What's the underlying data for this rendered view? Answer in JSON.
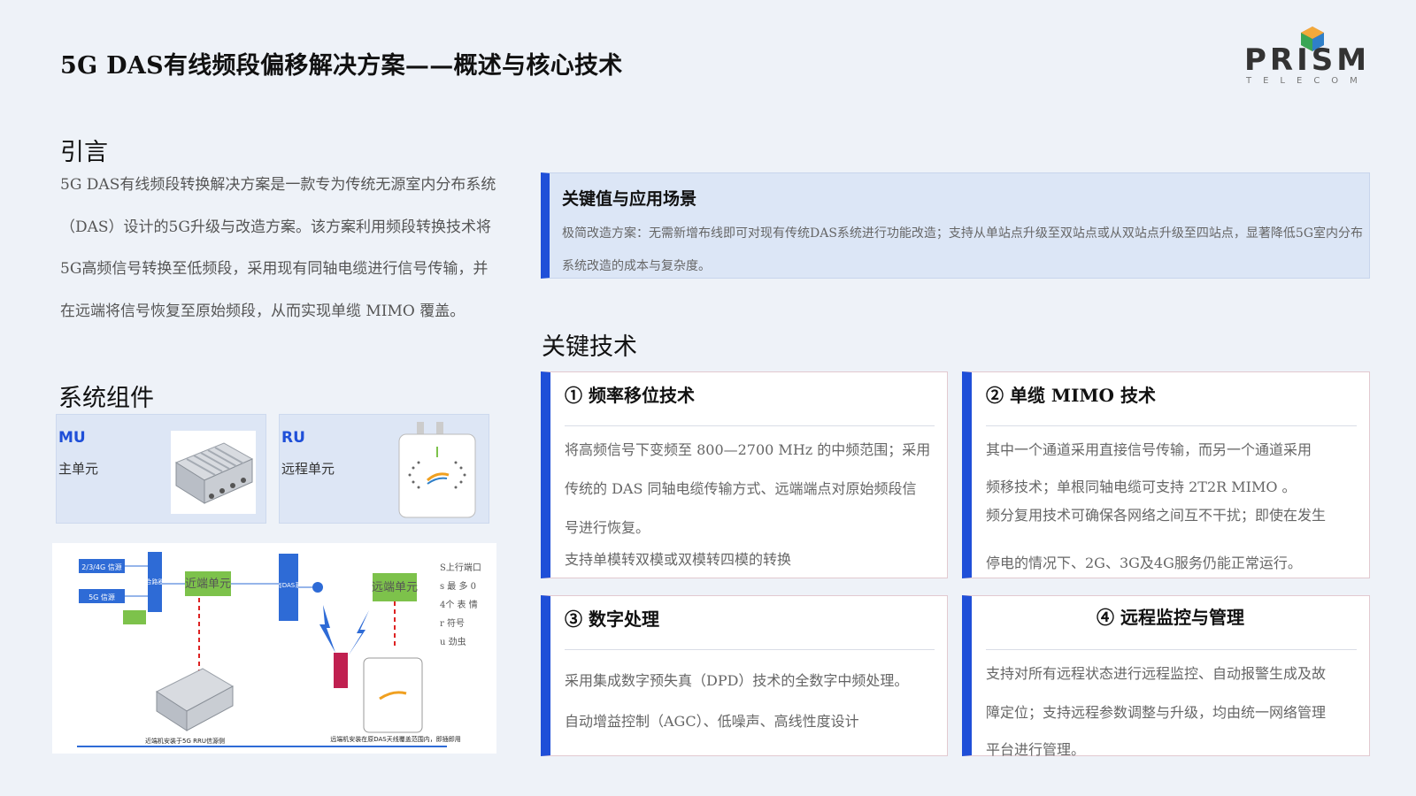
{
  "header": {
    "title": "5G DAS有线频段偏移解决方案——概述与核心技术",
    "logo_main": "PRISM",
    "logo_sub": "TELECOM"
  },
  "intro": {
    "heading": "引言",
    "text": "5G DAS有线频段转换解决方案是一款专为传统无源室内分布系统（DAS）设计的5G升级与改造方案。该方案利用频段转换技术将5G高频信号转换至低频段，采用现有同轴电缆进行信号传输，并在远端将信号恢复至原始频段，从而实现单缆 MIMO 覆盖。"
  },
  "components": {
    "heading": "系统组件",
    "items": [
      {
        "code": "MU",
        "name": "主单元"
      },
      {
        "code": "RU",
        "name": "远程单元"
      }
    ]
  },
  "diagram": {
    "labels": {
      "sig_234g": "2/3/4G 信源",
      "sig_5g": "5G 信源",
      "combiner": "合路器",
      "near_unit": "近端单元",
      "das": "原有DAS系统",
      "far_unit": "远端单元",
      "caption_left": "近端机安装于5G RRU信源侧",
      "caption_right": "远端机安装在原DAS天线覆盖范围内，即插即用"
    },
    "side_lines": [
      "S上行端口",
      "s 最 多  0",
      "4个 表 情",
      "r 符号",
      "u 劲虫"
    ]
  },
  "highlight": {
    "title": "关键值与应用场景",
    "body": "极简改造方案：无需新增布线即可对现有传统DAS系统进行功能改造；支持从单站点升级至双站点或从双站点升级至四站点，显著降低5G室内分布系统改造的成本与复杂度。"
  },
  "tech": {
    "heading": "关键技术",
    "cards": [
      {
        "title": "① 频率移位技术",
        "lines": [
          "将高频信号下变频至 800—2700 MHz 的中频范围；采用",
          "传统的 DAS 同轴电缆传输方式、远端端点对原始频段信",
          "号进行恢复。",
          "支持单模转双模或双模转四模的转换"
        ]
      },
      {
        "title": "② 单缆 MIMO 技术",
        "lines": [
          "其中一个通道采用直接信号传输，而另一个通道采用",
          "频移技术；单根同轴电缆可支持 2T2R MIMO 。",
          "频分复用技术可确保各网络之间互不干扰；即使在发生",
          "停电的情况下、2G、3G及4G服务仍能正常运行。"
        ]
      },
      {
        "title": "③ 数字处理",
        "lines": [
          "采用集成数字预失真（DPD）技术的全数字中频处理。",
          "自动增益控制（AGC）、低噪声、高线性度设计"
        ]
      },
      {
        "title": "④ 远程监控与管理",
        "lines": [
          "支持对所有远程状态进行远程监控、自动报警生成及故",
          "障定位；支持远程参数调整与升级，均由统一网络管理",
          "平台进行管理。"
        ]
      }
    ]
  },
  "colors": {
    "accent": "#1f4fd8",
    "background": "#eef2f8",
    "green": "#7dc24b"
  }
}
